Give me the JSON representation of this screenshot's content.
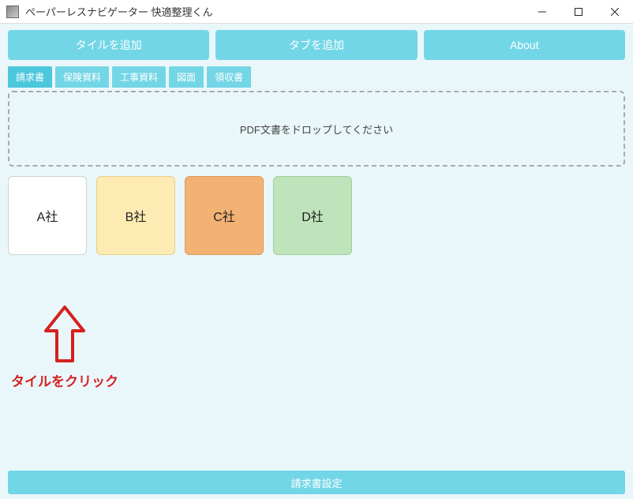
{
  "window": {
    "title": "ペーパーレスナビゲーター 快適整理くん"
  },
  "topButtons": {
    "addTile": "タイルを追加",
    "addTab": "タブを追加",
    "about": "About"
  },
  "tabs": [
    {
      "label": "請求書",
      "active": true
    },
    {
      "label": "保険資料",
      "active": false
    },
    {
      "label": "工事資料",
      "active": false
    },
    {
      "label": "図面",
      "active": false
    },
    {
      "label": "領収書",
      "active": false
    }
  ],
  "dropzone": {
    "hint": "PDF文書をドロップしてください"
  },
  "tiles": [
    {
      "label": "A社"
    },
    {
      "label": "B社"
    },
    {
      "label": "C社"
    },
    {
      "label": "D社"
    }
  ],
  "annotation": {
    "text": "タイルをクリック"
  },
  "bottom": {
    "label": "請求書設定"
  }
}
